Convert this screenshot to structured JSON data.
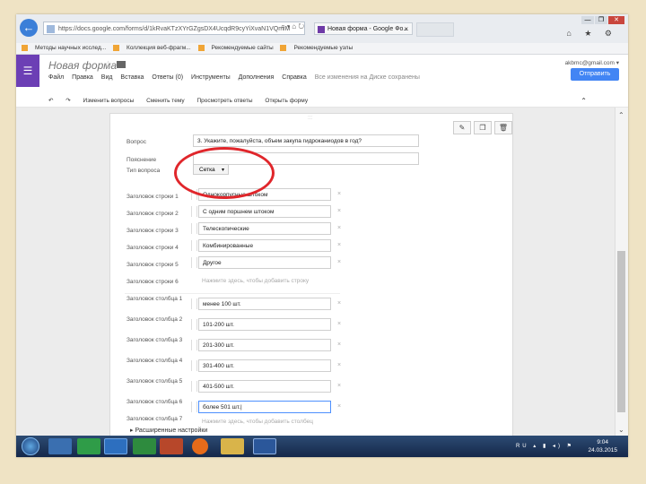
{
  "browser": {
    "back_glyph": "←",
    "url": "https://docs.google.com/forms/d/1kRvaKTzXYrGZgsDX4UcqdR9cyYiXvaN1VQmiM",
    "address_icons": "⌕ ▾ ⌂ ↻",
    "tab_title": "Новая форма - Google Фо...",
    "tab_close": "×",
    "window_controls": [
      "—",
      "❐",
      "✕"
    ],
    "toolbar_icons": "⌂ ★ ⚙"
  },
  "bookmarks": [
    "Методы научных исслед...",
    "Коллекция веб-фрагм...",
    "Рекомендуемые сайты",
    "Рекомендуемые узлы"
  ],
  "forms": {
    "menu_glyph": "☰",
    "title": "Новая форма",
    "star_glyph": "☆",
    "menu": [
      "Файл",
      "Правка",
      "Вид",
      "Вставка",
      "Ответы (0)",
      "Инструменты",
      "Дополнения",
      "Справка"
    ],
    "saved_status": "Все изменения на Диске сохранены",
    "user_email": "akbmc@gmail.com ▾",
    "send_button": "Отправить"
  },
  "toolbar2": {
    "undo": "↶",
    "redo": "↷",
    "edit_questions": "Изменить вопросы",
    "change_theme": "Сменить тему",
    "view_responses": "Просмотреть ответы",
    "view_form": "Открыть форму",
    "collapse_glyph": "⌃"
  },
  "editor": {
    "drag_handle": ":::",
    "action_icons": [
      "✎",
      "❐",
      "🗑"
    ],
    "question_label": "Вопрос",
    "question_value": "3. Укажите, пожалуйста, объем закупа гидроканиодов в год?",
    "help_label": "Пояснение",
    "help_value": "",
    "type_label": "Тип вопроса",
    "type_value": "Сетка",
    "type_arrow": "▾",
    "remove_glyph": "×",
    "rows": [
      {
        "label": "Заголовок строки 1",
        "value": "Однокорпусные штоком"
      },
      {
        "label": "Заголовок строки 2",
        "value": "С одним поршнем штоком"
      },
      {
        "label": "Заголовок строки 3",
        "value": "Телескопические"
      },
      {
        "label": "Заголовок строки 4",
        "value": "Комбинированные"
      },
      {
        "label": "Заголовок строки 5",
        "value": "Другое"
      }
    ],
    "row_new_label": "Заголовок строки 6",
    "row_new_hint": "Нажмите здесь, чтобы добавить строку",
    "columns": [
      {
        "label": "Заголовок столбца 1",
        "value": "менее 100 шт."
      },
      {
        "label": "Заголовок столбца 2",
        "value": "101-200 шт."
      },
      {
        "label": "Заголовок столбца 3",
        "value": "201-300 шт."
      },
      {
        "label": "Заголовок столбца 4",
        "value": "301-400 шт."
      },
      {
        "label": "Заголовок столбца 5",
        "value": "401-500 шт."
      },
      {
        "label": "Заголовок столбца 6",
        "value": "более 501 шт.|"
      }
    ],
    "column_new_label": "Заголовок столбца 7",
    "column_new_hint": "Нажмите здесь, чтобы добавить столбец",
    "advanced": "▸ Расширенные настройки"
  },
  "scroll": {
    "up": "⌃",
    "down": "⌄"
  },
  "taskbar": {
    "tray": "RU ▴ ▮ ◂) ⚑",
    "time": "9:04",
    "date": "24.03.2015"
  }
}
